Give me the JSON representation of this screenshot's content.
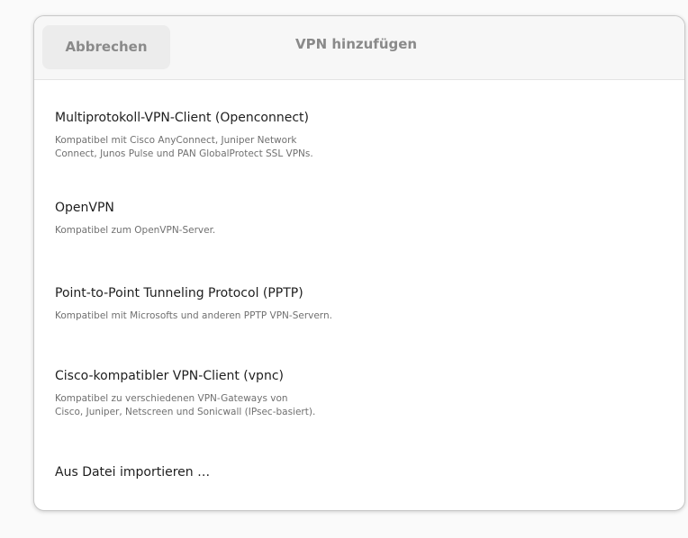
{
  "dialog": {
    "cancel_label": "Abbrechen",
    "title": "VPN hinzufügen"
  },
  "items": [
    {
      "title": "Multiprotokoll-VPN-Client (Openconnect)",
      "description": "Kompatibel mit Cisco AnyConnect, Juniper Network\nConnect, Junos Pulse und PAN GlobalProtect SSL VPNs."
    },
    {
      "title": "OpenVPN",
      "description": "Kompatibel zum OpenVPN-Server."
    },
    {
      "title": "Point-to-Point Tunneling Protocol (PPTP)",
      "description": "Kompatibel mit Microsofts und anderen PPTP VPN-Servern."
    },
    {
      "title": "Cisco-kompatibler VPN-Client (vpnc)",
      "description": "Kompatibel zu verschiedenen VPN-Gateways von\nCisco, Juniper, Netscreen und Sonicwall (IPsec-basiert)."
    },
    {
      "title": "Aus Datei importieren …"
    }
  ]
}
